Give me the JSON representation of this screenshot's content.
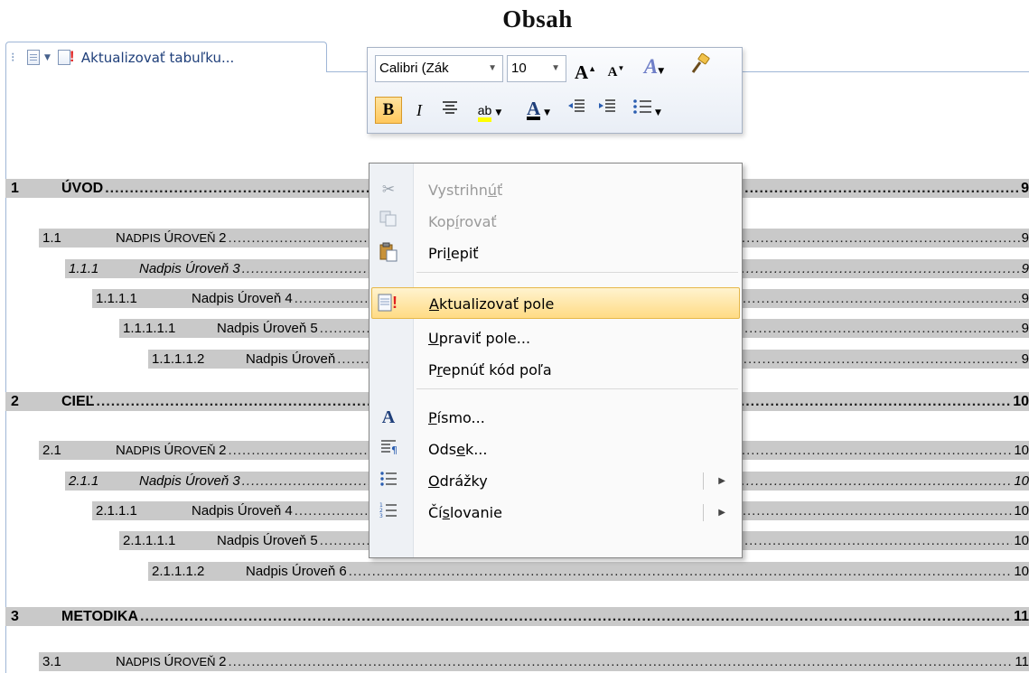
{
  "document": {
    "title": "Obsah"
  },
  "field_tab": {
    "update_label": "Aktualizovať tabuľku..."
  },
  "toc": [
    {
      "number": "1",
      "text": "ÚVOD",
      "page": "9",
      "level": 1
    },
    {
      "number": "1.1",
      "text": "Nadpis Úroveň 2",
      "page": "9",
      "level": 2
    },
    {
      "number": "1.1.1",
      "text": "Nadpis Úroveň 3",
      "page": "9",
      "level": 3
    },
    {
      "number": "1.1.1.1",
      "text": "Nadpis Úroveň 4",
      "page": "9",
      "level": 4
    },
    {
      "number": "1.1.1.1.1",
      "text": "Nadpis Úroveň 5",
      "page": "9",
      "level": 5
    },
    {
      "number": "1.1.1.1.2",
      "text": "Nadpis Úroveň",
      "page": "9",
      "level": 6
    },
    {
      "number": "2",
      "text": "CIEĽ",
      "page": "10",
      "level": 1
    },
    {
      "number": "2.1",
      "text": "Nadpis Úroveň 2",
      "page": "10",
      "level": 2
    },
    {
      "number": "2.1.1",
      "text": "Nadpis Úroveň 3",
      "page": "10",
      "level": 3
    },
    {
      "number": "2.1.1.1",
      "text": "Nadpis Úroveň 4",
      "page": "10",
      "level": 4
    },
    {
      "number": "2.1.1.1.1",
      "text": "Nadpis Úroveň 5",
      "page": "10",
      "level": 5
    },
    {
      "number": "2.1.1.1.2",
      "text": "Nadpis Úroveň 6",
      "page": "10",
      "level": 6
    },
    {
      "number": "3",
      "text": "METODIKA",
      "page": "11",
      "level": 1
    },
    {
      "number": "3.1",
      "text": "Nadpis Úroveň 2",
      "page": "11",
      "level": 2
    }
  ],
  "mini_toolbar": {
    "font": "Calibri (Zák",
    "size": "10",
    "grow_font": "A",
    "shrink_font": "A",
    "bold": "B",
    "italic": "I"
  },
  "context_menu": {
    "items": [
      {
        "label": "Vystrihnúť",
        "enabled": false
      },
      {
        "label": "Kopírovať",
        "enabled": false
      },
      {
        "label": "Prilepiť",
        "enabled": true
      },
      {
        "label": "Aktualizovať pole",
        "enabled": true,
        "highlighted": true
      },
      {
        "label": "Upraviť pole...",
        "enabled": true
      },
      {
        "label": "Prepnúť kód poľa",
        "enabled": true
      },
      {
        "label": "Písmo...",
        "enabled": true
      },
      {
        "label": "Odsek...",
        "enabled": true
      },
      {
        "label": "Odrážky",
        "enabled": true,
        "submenu": true
      },
      {
        "label": "Číslovanie",
        "enabled": true,
        "submenu": true
      }
    ]
  },
  "colors": {
    "toc_shading": "#c9c9c9",
    "highlight": "#ffdb84",
    "frame": "#9fb6d6"
  }
}
